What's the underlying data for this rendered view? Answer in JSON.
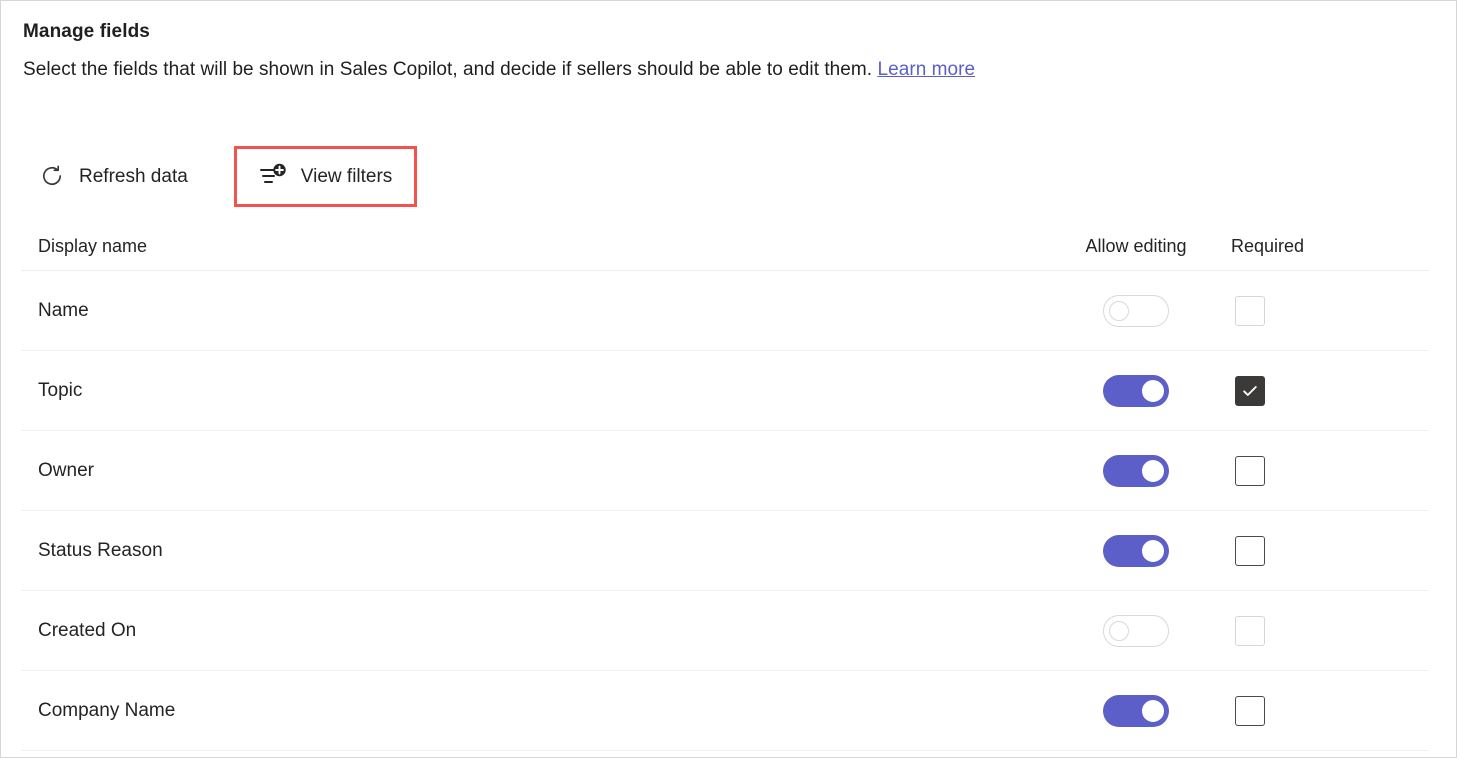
{
  "header": {
    "title": "Manage fields",
    "subtitle_text": "Select the fields that will be shown in Sales Copilot, and decide if sellers should be able to edit them.",
    "learn_more_label": "Learn more"
  },
  "commandbar": {
    "refresh": {
      "label": "Refresh data",
      "icon": "refresh-icon"
    },
    "view_filters": {
      "label": "View filters",
      "icon": "filter-add-icon",
      "highlighted": true
    }
  },
  "table": {
    "columns": {
      "display_name": "Display name",
      "allow_editing": "Allow editing",
      "required": "Required"
    },
    "rows": [
      {
        "display_name": "Name",
        "allow_editing": false,
        "allow_editing_disabled": true,
        "required": false,
        "required_disabled": true
      },
      {
        "display_name": "Topic",
        "allow_editing": true,
        "allow_editing_disabled": false,
        "required": true,
        "required_disabled": false
      },
      {
        "display_name": "Owner",
        "allow_editing": true,
        "allow_editing_disabled": false,
        "required": false,
        "required_disabled": false
      },
      {
        "display_name": "Status Reason",
        "allow_editing": true,
        "allow_editing_disabled": false,
        "required": false,
        "required_disabled": false
      },
      {
        "display_name": "Created On",
        "allow_editing": false,
        "allow_editing_disabled": true,
        "required": false,
        "required_disabled": true
      },
      {
        "display_name": "Company Name",
        "allow_editing": true,
        "allow_editing_disabled": false,
        "required": false,
        "required_disabled": false
      }
    ]
  },
  "colors": {
    "toggle_on": "#5b5fc7",
    "link": "#5b5fc7",
    "checkbox_checked": "#3b3a39",
    "highlight_border": "#f4524d",
    "text": "#242424"
  }
}
